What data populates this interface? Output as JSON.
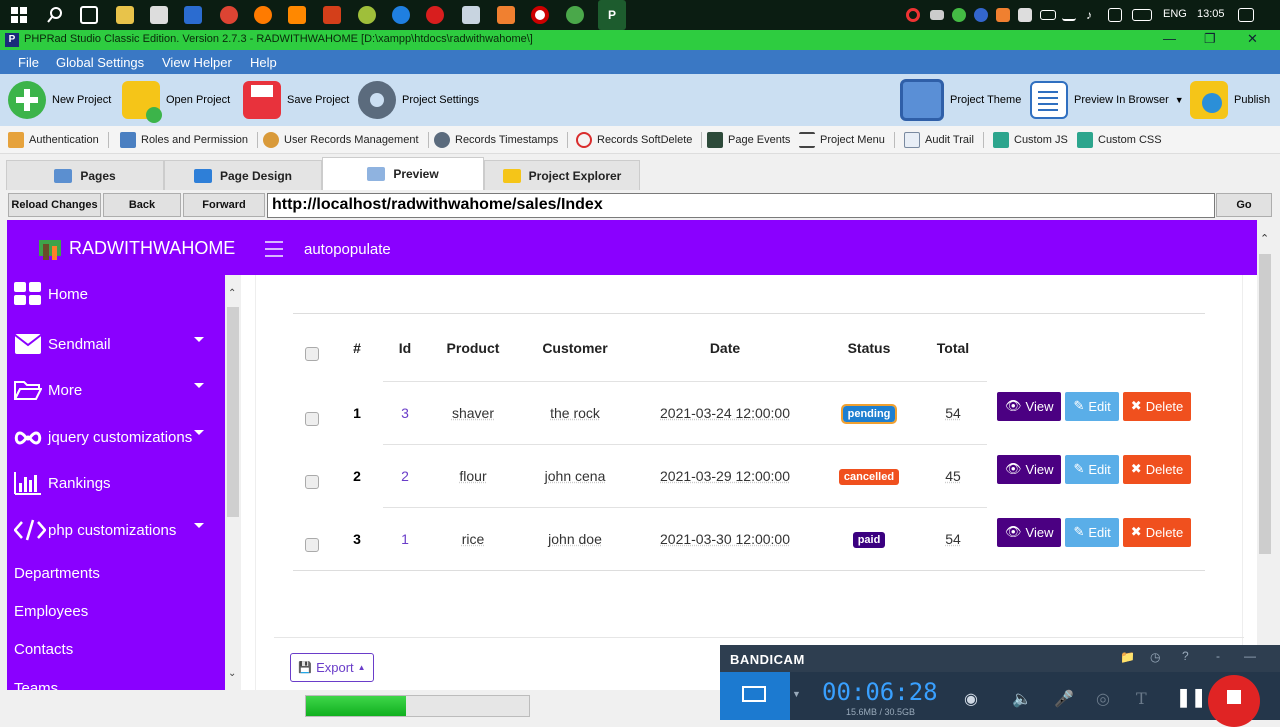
{
  "taskbar": {
    "language": "ENG",
    "time": "13:05"
  },
  "window": {
    "title": "PHPRad Studio Classic Edition.  Version 2.7.3 - RADWITHWAHOME [D:\\xampp\\htdocs\\radwithwahome\\]"
  },
  "menu": [
    "File",
    "Global Settings",
    "View Helper",
    "Help"
  ],
  "toolbar": {
    "new_project": "New Project",
    "open_project": "Open Project",
    "save_project": "Save Project",
    "project_settings": "Project Settings",
    "project_theme": "Project Theme",
    "preview_in_browser": "Preview In Browser",
    "publish": "Publish"
  },
  "toolbar2": [
    "Authentication",
    "Roles and Permission",
    "User Records Management",
    "Records Timestamps",
    "Records SoftDelete",
    "Page Events",
    "Project Menu",
    "Audit Trail",
    "Custom JS",
    "Custom CSS"
  ],
  "tabs": [
    "Pages",
    "Page Design",
    "Preview",
    "Project Explorer"
  ],
  "nav": {
    "reload": "Reload Changes",
    "back": "Back",
    "forward": "Forward",
    "url": "http://localhost/radwithwahome/sales/Index",
    "go": "Go"
  },
  "app": {
    "brand": "RADWITHWAHOME",
    "crumb": "autopopulate",
    "sidebar": [
      "Home",
      "Sendmail",
      "More",
      "jquery customizations",
      "Rankings",
      "php customizations",
      "Departments",
      "Employees",
      "Contacts",
      "Teams"
    ],
    "table": {
      "headers": [
        "#",
        "Id",
        "Product",
        "Customer",
        "Date",
        "Status",
        "Total"
      ],
      "rows": [
        {
          "n": "1",
          "id": "3",
          "product": "shaver",
          "customer": "the rock",
          "date": "2021-03-24 12:00:00",
          "status": "pending",
          "total": "54"
        },
        {
          "n": "2",
          "id": "2",
          "product": "flour",
          "customer": "john cena",
          "date": "2021-03-29 12:00:00",
          "status": "cancelled",
          "total": "45"
        },
        {
          "n": "3",
          "id": "1",
          "product": "rice",
          "customer": "john doe",
          "date": "2021-03-30 12:00:00",
          "status": "paid",
          "total": "54"
        }
      ]
    },
    "actions": {
      "view": "View",
      "edit": "Edit",
      "delete": "Delete"
    },
    "export": "Export",
    "colors": {
      "primary": "#8a00ff",
      "view": "#4b0082",
      "edit": "#5aaee8",
      "delete": "#f0501e",
      "pending": "#1e7fd0",
      "cancelled": "#f0501e",
      "paid": "#3b0080"
    }
  },
  "status": {
    "progress": 0.45
  },
  "bandicam": {
    "name": "BANDICAM",
    "timer": "00:06:28",
    "size": "15.6MB / 30.5GB"
  }
}
